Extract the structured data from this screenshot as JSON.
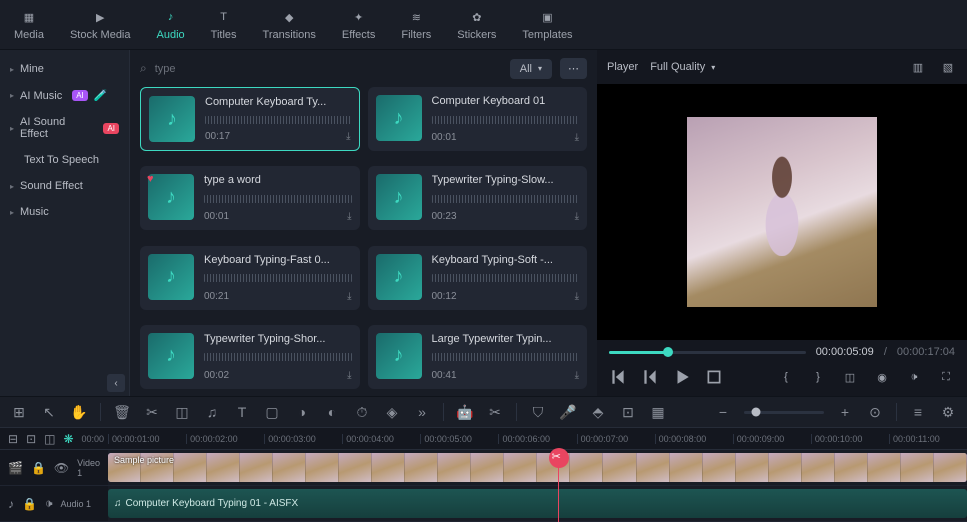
{
  "topnav": [
    {
      "id": "media",
      "label": "Media"
    },
    {
      "id": "stock",
      "label": "Stock Media"
    },
    {
      "id": "audio",
      "label": "Audio"
    },
    {
      "id": "titles",
      "label": "Titles"
    },
    {
      "id": "transitions",
      "label": "Transitions"
    },
    {
      "id": "effects",
      "label": "Effects"
    },
    {
      "id": "filters",
      "label": "Filters"
    },
    {
      "id": "stickers",
      "label": "Stickers"
    },
    {
      "id": "templates",
      "label": "Templates"
    }
  ],
  "topnav_active": "audio",
  "sidebar": {
    "items": [
      {
        "label": "Mine",
        "badge": null
      },
      {
        "label": "AI Music",
        "badge": "AI",
        "badge_cls": "ai",
        "extra": "🧪"
      },
      {
        "label": "AI Sound Effect",
        "badge": "AI",
        "badge_cls": "ai2"
      },
      {
        "label": "Text To Speech",
        "badge": null,
        "no_caret": true
      },
      {
        "label": "Sound Effect",
        "badge": null
      },
      {
        "label": "Music",
        "badge": null
      }
    ]
  },
  "search": {
    "placeholder": "type"
  },
  "filter": {
    "label": "All"
  },
  "cards": [
    {
      "title": "Computer Keyboard Ty...",
      "dur": "00:17",
      "selected": true
    },
    {
      "title": "Computer Keyboard 01",
      "dur": "00:01"
    },
    {
      "title": "type a word",
      "dur": "00:01",
      "heart": true
    },
    {
      "title": "Typewriter Typing-Slow...",
      "dur": "00:23"
    },
    {
      "title": "Keyboard Typing-Fast 0...",
      "dur": "00:21"
    },
    {
      "title": "Keyboard Typing-Soft -...",
      "dur": "00:12"
    },
    {
      "title": "Typewriter Typing-Shor...",
      "dur": "00:02"
    },
    {
      "title": "Large Typewriter Typin...",
      "dur": "00:41"
    }
  ],
  "player": {
    "tab": "Player",
    "quality": "Full Quality",
    "time_current": "00:00:05:09",
    "time_total": "00:00:17:04",
    "separator": "/"
  },
  "ruler": {
    "start": "00:00",
    "ticks": [
      "00:00:01:00",
      "00:00:02:00",
      "00:00:03:00",
      "00:00:04:00",
      "00:00:05:00",
      "00:00:06:00",
      "00:00:07:00",
      "00:00:08:00",
      "00:00:09:00",
      "00:00:10:00",
      "00:00:11:00"
    ]
  },
  "tracks": {
    "video": {
      "name": "Video 1",
      "clip_label": "Sample picture"
    },
    "audio": {
      "name": "Audio 1",
      "clip_label": "Computer Keyboard Typing 01 - AISFX"
    }
  }
}
